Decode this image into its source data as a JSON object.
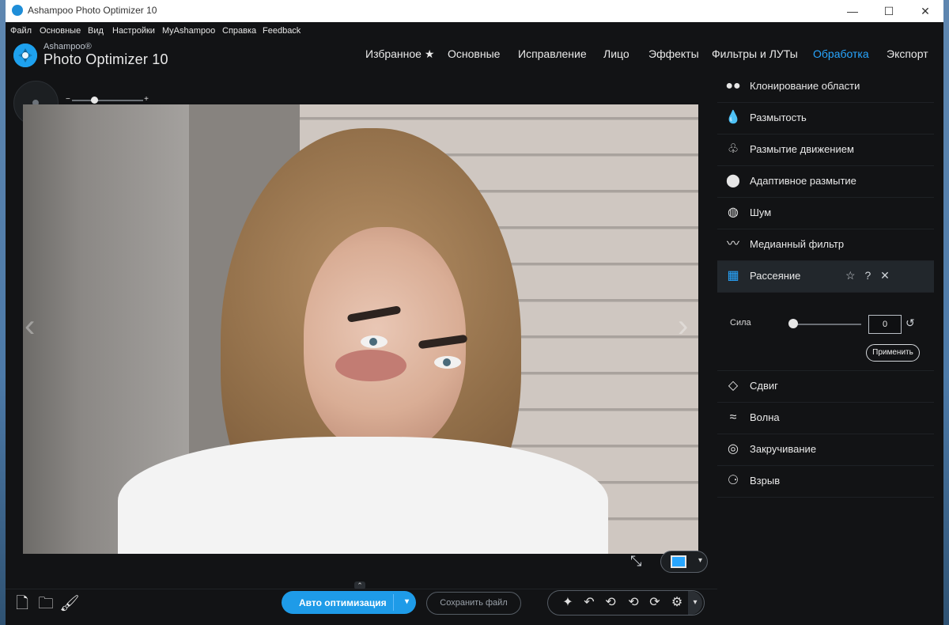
{
  "window": {
    "title": "Ashampoo Photo Optimizer 10",
    "controls": {
      "minimize": "—",
      "maximize": "☐",
      "close": "✕"
    }
  },
  "menubar": [
    "Файл",
    "Основные",
    "Вид",
    "Настройки",
    "MyAshampoo",
    "Справка",
    "Feedback"
  ],
  "brand": {
    "top": "Ashampoo®",
    "main": "Photo Optimizer 10"
  },
  "tabs": [
    {
      "label": "Избранное ★",
      "active": false
    },
    {
      "label": "Основные",
      "active": false
    },
    {
      "label": "Исправление",
      "active": false
    },
    {
      "label": "Лицо",
      "active": false
    },
    {
      "label": "Эффекты",
      "active": false
    },
    {
      "label": "Фильтры и ЛУТы",
      "active": false
    },
    {
      "label": "Обработка",
      "active": true
    },
    {
      "label": "Экспорт",
      "active": false
    }
  ],
  "zoom": {
    "minus": "−",
    "plus": "+"
  },
  "effects": [
    {
      "label": "Клонирование области",
      "icon": "clone-icon"
    },
    {
      "label": "Размытость",
      "icon": "drop-icon"
    },
    {
      "label": "Размытие движением",
      "icon": "motion-blur-icon"
    },
    {
      "label": "Адаптивное размытие",
      "icon": "adaptive-blur-icon"
    },
    {
      "label": "Шум",
      "icon": "noise-icon"
    },
    {
      "label": "Медианный фильтр",
      "icon": "median-icon"
    },
    {
      "label": "Рассеяние",
      "icon": "diffuse-icon",
      "selected": true
    },
    {
      "label": "Сдвиг",
      "icon": "shift-icon"
    },
    {
      "label": "Волна",
      "icon": "wave-icon"
    },
    {
      "label": "Закручивание",
      "icon": "swirl-icon"
    },
    {
      "label": "Взрыв",
      "icon": "explode-icon"
    }
  ],
  "selected_details": {
    "strength_label": "Сила",
    "strength_value": "0",
    "strength_fraction": 0,
    "apply_label": "Применить"
  },
  "bottom": {
    "auto_optimize": "Авто оптимизация",
    "save_file": "Сохранить файл"
  },
  "colors": {
    "accent": "#28a6ff",
    "primary_button": "#1e9be8",
    "background": "#121315"
  }
}
